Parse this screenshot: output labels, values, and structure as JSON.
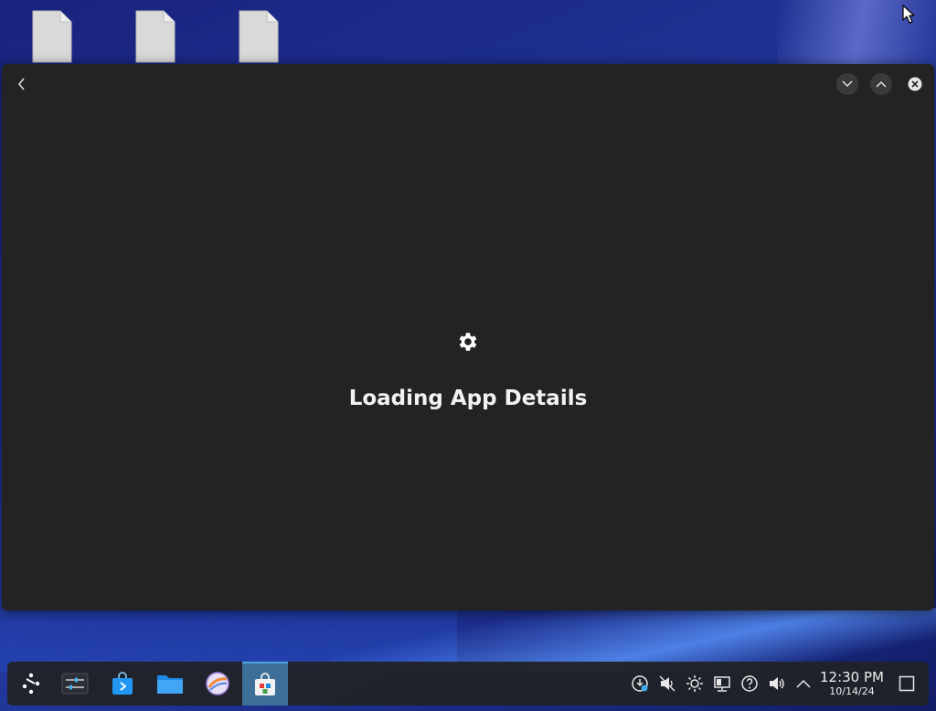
{
  "desktop": {
    "files": [
      {
        "icon": "file-icon"
      },
      {
        "icon": "file-icon"
      },
      {
        "icon": "file-icon"
      }
    ]
  },
  "window": {
    "back_icon": "chevron-left-icon",
    "controls": [
      "minimize-icon",
      "maximize-icon",
      "close-icon"
    ],
    "loading": {
      "icon": "gear-icon",
      "text": "Loading App Details"
    }
  },
  "taskbar": {
    "apps": [
      {
        "name": "application-launcher",
        "icon": "kde-launcher-icon"
      },
      {
        "name": "system-settings",
        "icon": "settings-sliders-icon"
      },
      {
        "name": "discover-store",
        "icon": "store-bag-icon"
      },
      {
        "name": "file-manager",
        "icon": "folder-icon"
      },
      {
        "name": "web-browser",
        "icon": "browser-icon"
      },
      {
        "name": "discover-active",
        "icon": "discover-icon",
        "active": true
      }
    ],
    "tray": [
      "update-icon",
      "mute-icon",
      "brightness-icon",
      "network-icon",
      "help-icon",
      "volume-icon",
      "expand-tray-icon"
    ],
    "clock": {
      "time": "12:30 PM",
      "date": "10/14/24"
    },
    "show_desktop_icon": "show-desktop-icon"
  },
  "colors": {
    "window_bg": "#232323",
    "taskbar_bg": "#202228",
    "active_task": "#3e6f98",
    "accent": "#4fa3e0"
  }
}
